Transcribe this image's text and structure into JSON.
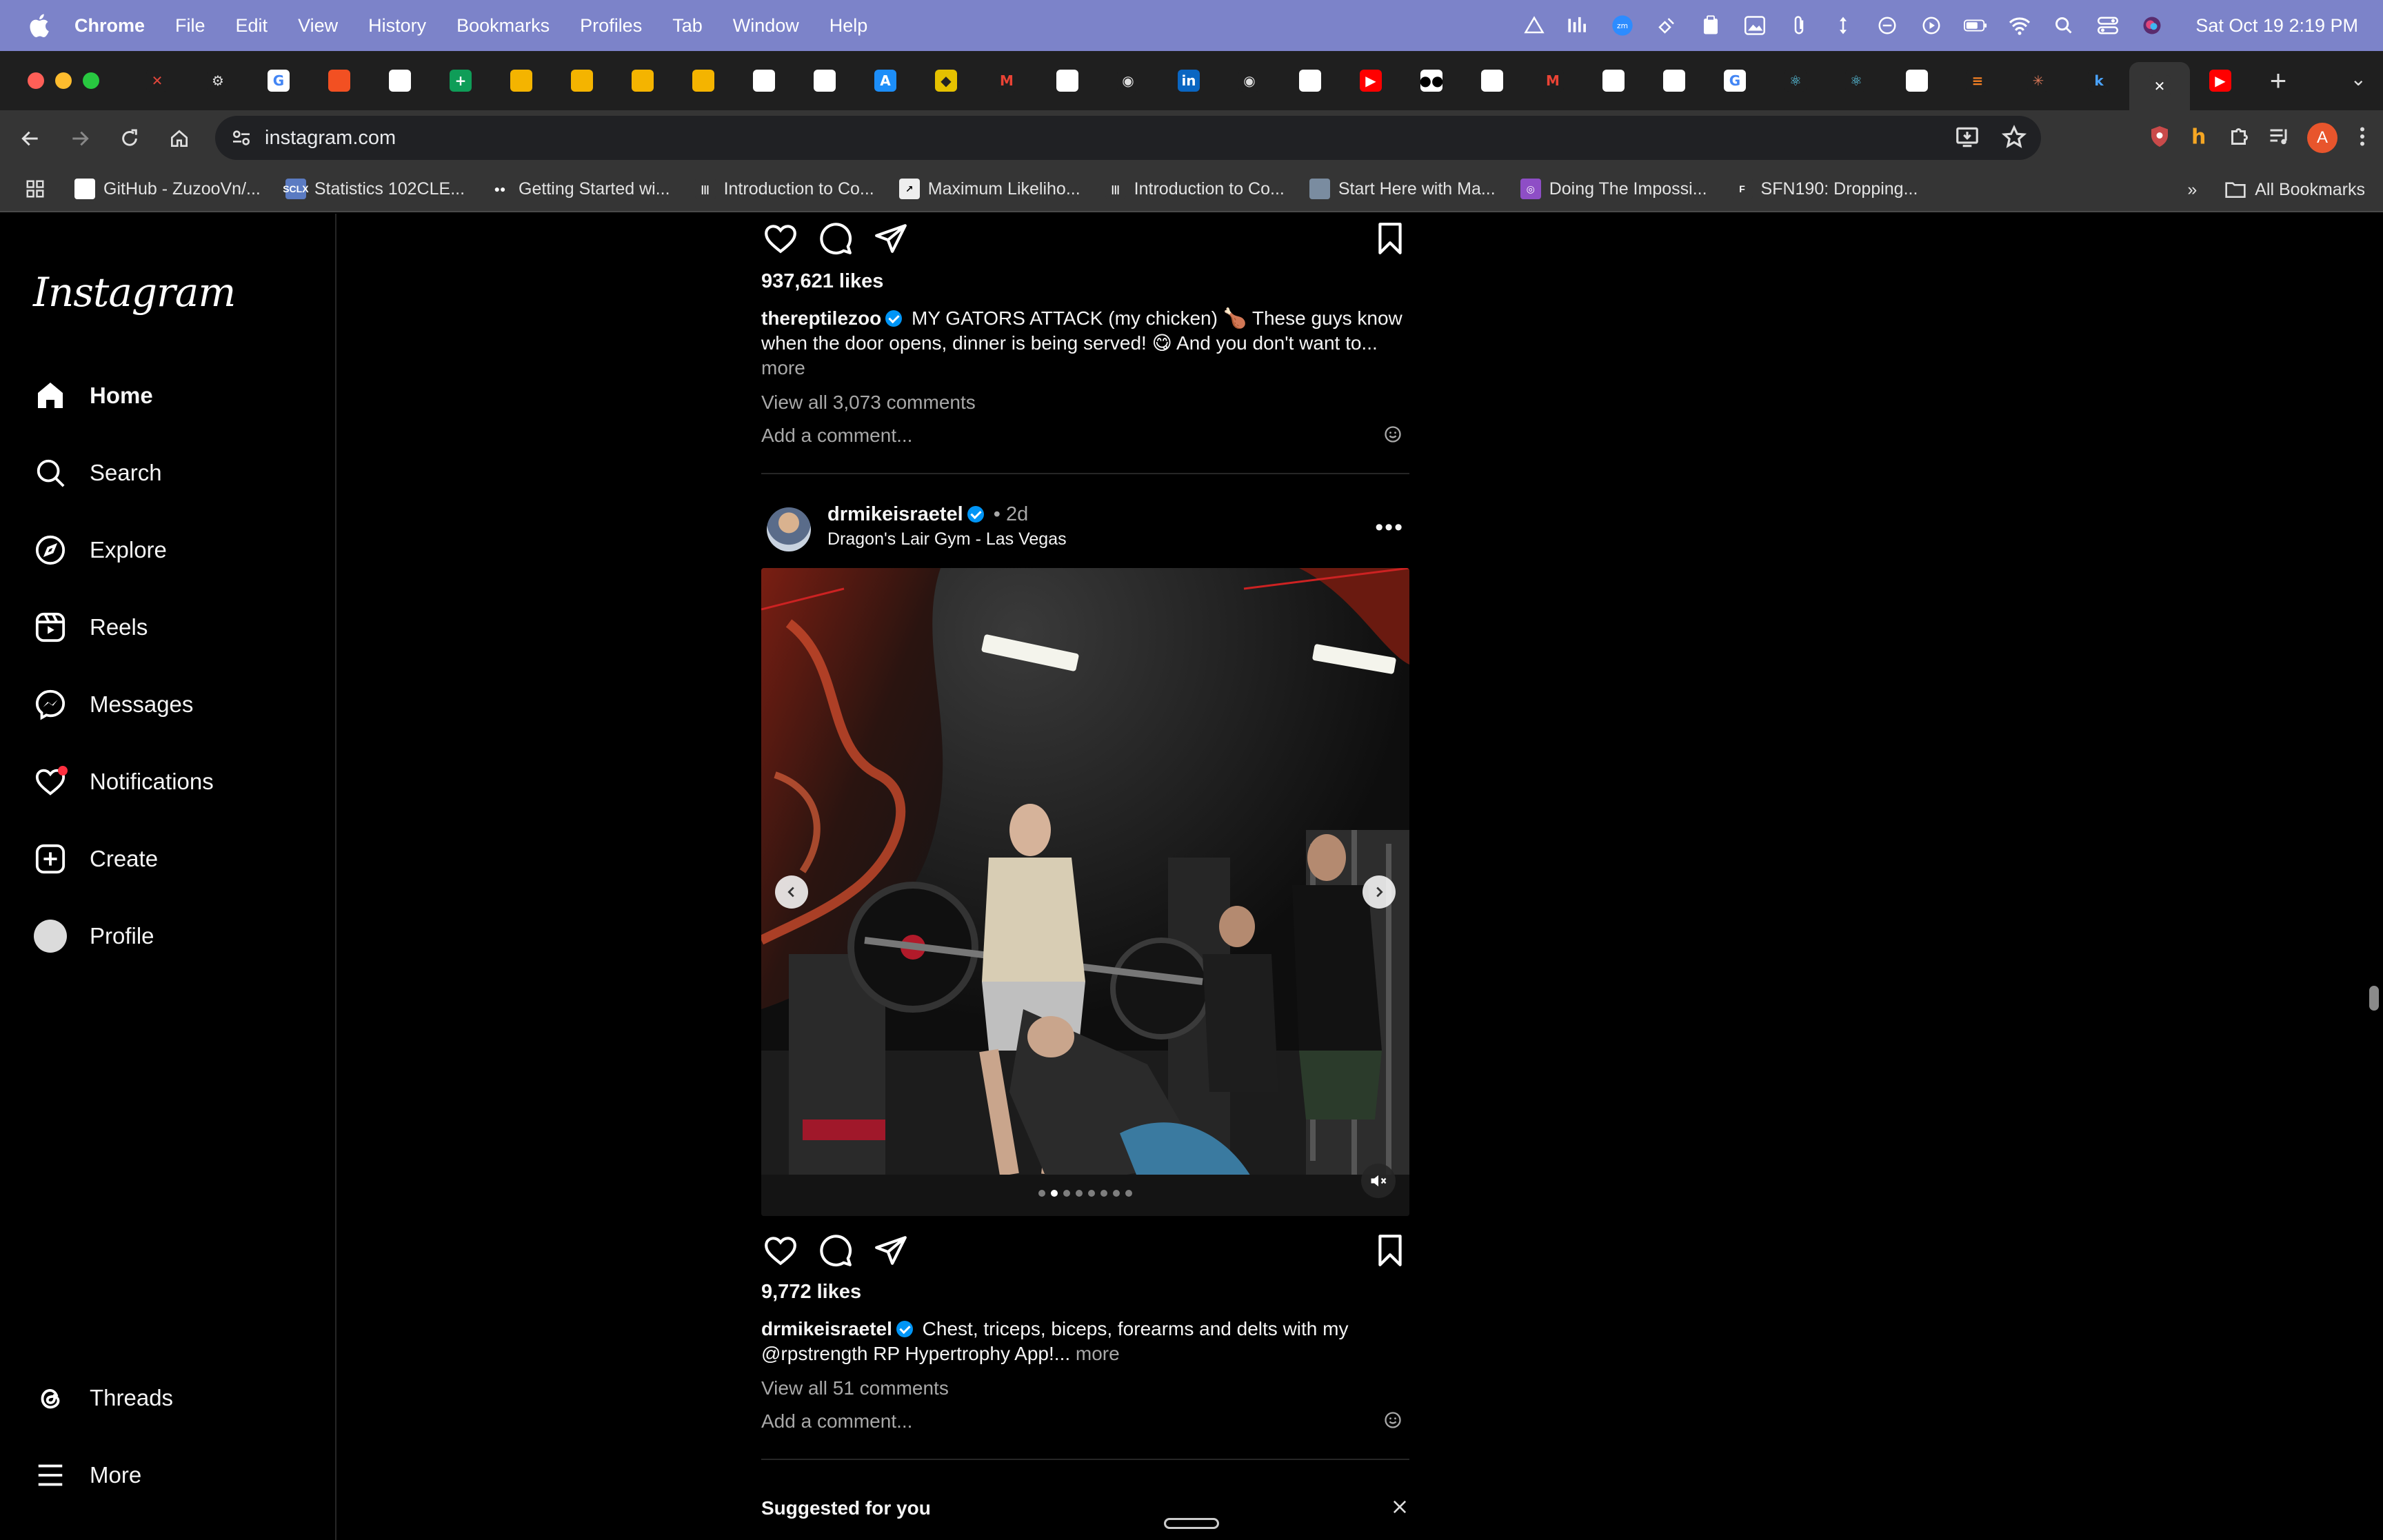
{
  "menubar": {
    "app": "Chrome",
    "items": [
      "File",
      "Edit",
      "View",
      "History",
      "Bookmarks",
      "Profiles",
      "Tab",
      "Window",
      "Help"
    ],
    "clock": "Sat Oct 19  2:19 PM"
  },
  "tabs": [
    {
      "icon": "x-icon",
      "glyph": "✕",
      "bg": "#1f1f1f",
      "fg": "#e0463b"
    },
    {
      "icon": "gear-icon",
      "glyph": "⚙",
      "bg": "#1f1f1f",
      "fg": "#ddd"
    },
    {
      "icon": "google-icon",
      "glyph": "G",
      "bg": "#fff",
      "fg": "#4285f4"
    },
    {
      "icon": "microsoft-icon",
      "glyph": "",
      "bg": "#f25022",
      "fg": "#fff"
    },
    {
      "icon": "github-icon",
      "glyph": "",
      "bg": "#fff",
      "fg": "#000"
    },
    {
      "icon": "sheets-icon",
      "glyph": "+",
      "bg": "#0f9d58",
      "fg": "#fff"
    },
    {
      "icon": "slides-icon",
      "glyph": "",
      "bg": "#f4b400",
      "fg": "#fff"
    },
    {
      "icon": "slides-icon",
      "glyph": "",
      "bg": "#f4b400",
      "fg": "#fff"
    },
    {
      "icon": "slides-icon",
      "glyph": "",
      "bg": "#f4b400",
      "fg": "#fff"
    },
    {
      "icon": "slides-icon",
      "glyph": "",
      "bg": "#f4b400",
      "fg": "#fff"
    },
    {
      "icon": "github-icon",
      "glyph": "",
      "bg": "#fff",
      "fg": "#000"
    },
    {
      "icon": "github-icon",
      "glyph": "",
      "bg": "#fff",
      "fg": "#000"
    },
    {
      "icon": "appstore-icon",
      "glyph": "A",
      "bg": "#1c8ef9",
      "fg": "#fff"
    },
    {
      "icon": "shield-icon",
      "glyph": "◆",
      "bg": "#e5c100",
      "fg": "#222"
    },
    {
      "icon": "gmail-icon",
      "glyph": "M",
      "bg": "#1f1f1f",
      "fg": "#ea4335"
    },
    {
      "icon": "github-icon",
      "glyph": "",
      "bg": "#fff",
      "fg": "#000"
    },
    {
      "icon": "chrome-icon",
      "glyph": "◉",
      "bg": "#1f1f1f",
      "fg": "#ddd"
    },
    {
      "icon": "linkedin-icon",
      "glyph": "in",
      "bg": "#0a66c2",
      "fg": "#fff"
    },
    {
      "icon": "chrome-icon",
      "glyph": "◉",
      "bg": "#1f1f1f",
      "fg": "#ddd"
    },
    {
      "icon": "github-icon",
      "glyph": "",
      "bg": "#fff",
      "fg": "#000"
    },
    {
      "icon": "youtube-icon",
      "glyph": "▶",
      "bg": "#ff0000",
      "fg": "#fff"
    },
    {
      "icon": "medium-icon",
      "glyph": "●●",
      "bg": "#fff",
      "fg": "#000"
    },
    {
      "icon": "github-icon",
      "glyph": "",
      "bg": "#fff",
      "fg": "#000"
    },
    {
      "icon": "gmail-icon",
      "glyph": "M",
      "bg": "#1f1f1f",
      "fg": "#ea4335"
    },
    {
      "icon": "github-icon",
      "glyph": "",
      "bg": "#fff",
      "fg": "#000"
    },
    {
      "icon": "github-icon",
      "glyph": "",
      "bg": "#fff",
      "fg": "#000"
    },
    {
      "icon": "google-icon",
      "glyph": "G",
      "bg": "#fff",
      "fg": "#4285f4"
    },
    {
      "icon": "react-icon",
      "glyph": "⚛",
      "bg": "#1f1f1f",
      "fg": "#61dafb"
    },
    {
      "icon": "react-icon",
      "glyph": "⚛",
      "bg": "#1f1f1f",
      "fg": "#61dafb"
    },
    {
      "icon": "github-icon",
      "glyph": "",
      "bg": "#fff",
      "fg": "#000"
    },
    {
      "icon": "stack-icon",
      "glyph": "≡",
      "bg": "#1f1f1f",
      "fg": "#f48024"
    },
    {
      "icon": "claude-icon",
      "glyph": "✳",
      "bg": "#1f1f1f",
      "fg": "#d97757"
    },
    {
      "icon": "k-icon",
      "glyph": "k",
      "bg": "#1f1f1f",
      "fg": "#4aa3ff"
    },
    {
      "icon": "close-icon",
      "glyph": "✕",
      "bg": "#353535",
      "fg": "#fff",
      "active": true
    },
    {
      "icon": "youtube-icon",
      "glyph": "▶",
      "bg": "#ff0000",
      "fg": "#fff"
    }
  ],
  "address": {
    "url": "instagram.com"
  },
  "bookmarks": [
    {
      "label": "GitHub - ZuzooVn/...",
      "icon": "github-icon",
      "bg": "#fff",
      "glyph": ""
    },
    {
      "label": "Statistics 102CLE...",
      "icon": "sclx-icon",
      "bg": "#5b7bc2",
      "glyph": "SCLX"
    },
    {
      "label": "Getting Started wi...",
      "icon": "medium-icon",
      "bg": "#353535",
      "glyph": "●●"
    },
    {
      "label": "Introduction to Co...",
      "icon": "mit-icon",
      "bg": "#353535",
      "glyph": "|||"
    },
    {
      "label": "Maximum Likeliho...",
      "icon": "chart-icon",
      "bg": "#eee",
      "glyph": "↗"
    },
    {
      "label": "Introduction to Co...",
      "icon": "mit-icon",
      "bg": "#353535",
      "glyph": "|||"
    },
    {
      "label": "Start Here with Ma...",
      "icon": "image-icon",
      "bg": "#7a8ca0",
      "glyph": ""
    },
    {
      "label": "Doing The Impossi...",
      "icon": "podcast-icon",
      "bg": "#8e4ec6",
      "glyph": "◎"
    },
    {
      "label": "SFN190: Dropping...",
      "icon": "f-icon",
      "bg": "#353535",
      "glyph": "F"
    }
  ],
  "bookmarks_all": "All Bookmarks",
  "sidebar": {
    "logo": "Instagram",
    "items": [
      {
        "label": "Home",
        "icon": "home-icon"
      },
      {
        "label": "Search",
        "icon": "search-icon"
      },
      {
        "label": "Explore",
        "icon": "compass-icon"
      },
      {
        "label": "Reels",
        "icon": "reels-icon"
      },
      {
        "label": "Messages",
        "icon": "messenger-icon"
      },
      {
        "label": "Notifications",
        "icon": "heart-icon"
      },
      {
        "label": "Create",
        "icon": "plus-square-icon"
      },
      {
        "label": "Profile",
        "icon": "avatar"
      }
    ],
    "bottom": [
      {
        "label": "Threads",
        "icon": "threads-icon"
      },
      {
        "label": "More",
        "icon": "menu-icon"
      }
    ]
  },
  "post1": {
    "likes": "937,621 likes",
    "user": "thereptilezoo",
    "caption_line1": "MY GATORS ATTACK (my chicken) 🍗 These guys know",
    "caption_line2": "when the door opens, dinner is being served! 😋 And you don't want to...",
    "more": "more",
    "view_all": "View all 3,073 comments",
    "add_comment": "Add a comment..."
  },
  "post2": {
    "user": "drmikeisraetel",
    "dot": "•",
    "ago": "2d",
    "location": "Dragon's Lair Gym - Las Vegas",
    "likes": "9,772 likes",
    "caption_line1": "Chest, triceps, biceps, forearms and delts with my",
    "caption_line2": "@rpstrength RP Hypertrophy App!...",
    "more": "more",
    "view_all": "View all 51 comments",
    "add_comment": "Add a comment...",
    "carousel": {
      "count": 8,
      "active_index": 1
    }
  },
  "suggested": {
    "title": "Suggested for you"
  },
  "colors": {
    "accent": "#0095f6",
    "notification": "#ff3040",
    "menubar": "#7c83c9"
  }
}
